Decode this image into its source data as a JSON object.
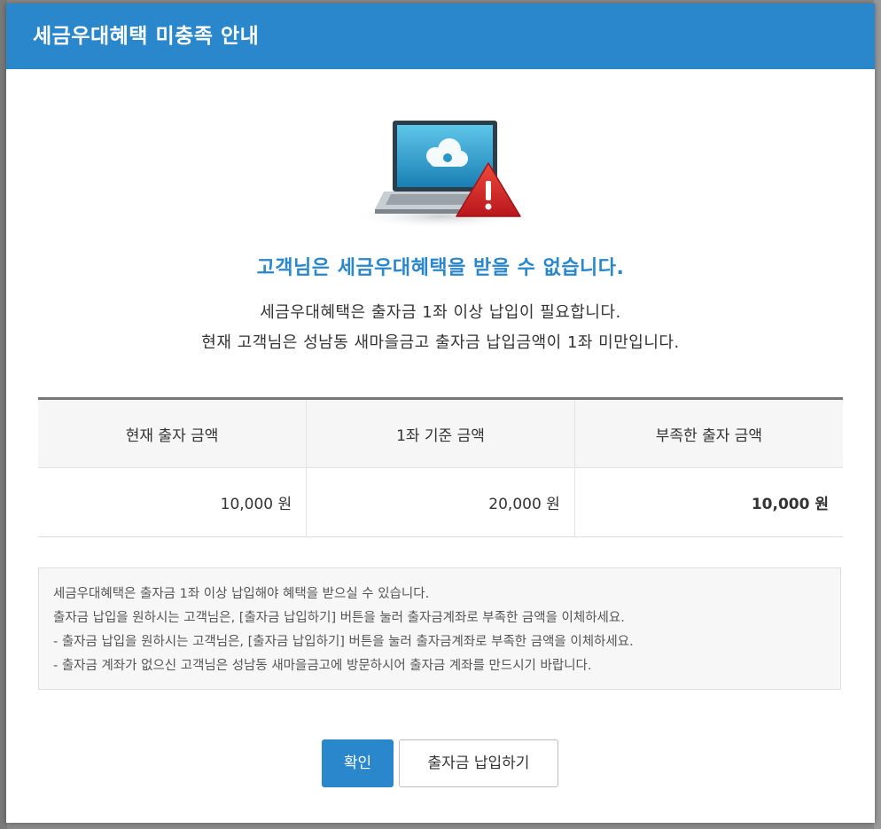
{
  "dialog": {
    "title": "세금우대혜택 미충족 안내",
    "headline": "고객님은 세금우대혜택을 받을 수 없습니다.",
    "description": [
      "세금우대혜택은 출자금 1좌 이상 납입이 필요합니다.",
      "현재 고객님은 성남동 새마을금고 출자금 납입금액이 1좌 미만입니다."
    ],
    "illustration_icon": "laptop-cloud-warning-icon"
  },
  "table": {
    "headers": [
      "현재 출자 금액",
      "1좌 기준 금액",
      "부족한 출자 금액"
    ],
    "values": [
      "10,000 원",
      "20,000 원",
      "10,000 원"
    ]
  },
  "notice": {
    "lines": [
      "세금우대혜택은 출자금 1좌 이상 납입해야 혜택을 받으실 수 있습니다.",
      "출자금 납입을 원하시는 고객님은, [출자금 납입하기] 버튼을 눌러 출자금계좌로 부족한 금액을 이체하세요.",
      "- 출자금 납입을 원하시는 고객님은, [출자금 납입하기] 버튼을 눌러 출자금계좌로 부족한 금액을 이체하세요.",
      "- 출자금 계좌가 없으신 고객님은 성남동 새마을금고에 방문하시어 출자금 계좌를 만드시기 바랍니다."
    ]
  },
  "buttons": {
    "confirm": "확인",
    "pay": "출자금 납입하기"
  },
  "colors": {
    "accent": "#2a87cc",
    "warning": "#d42a2a"
  }
}
